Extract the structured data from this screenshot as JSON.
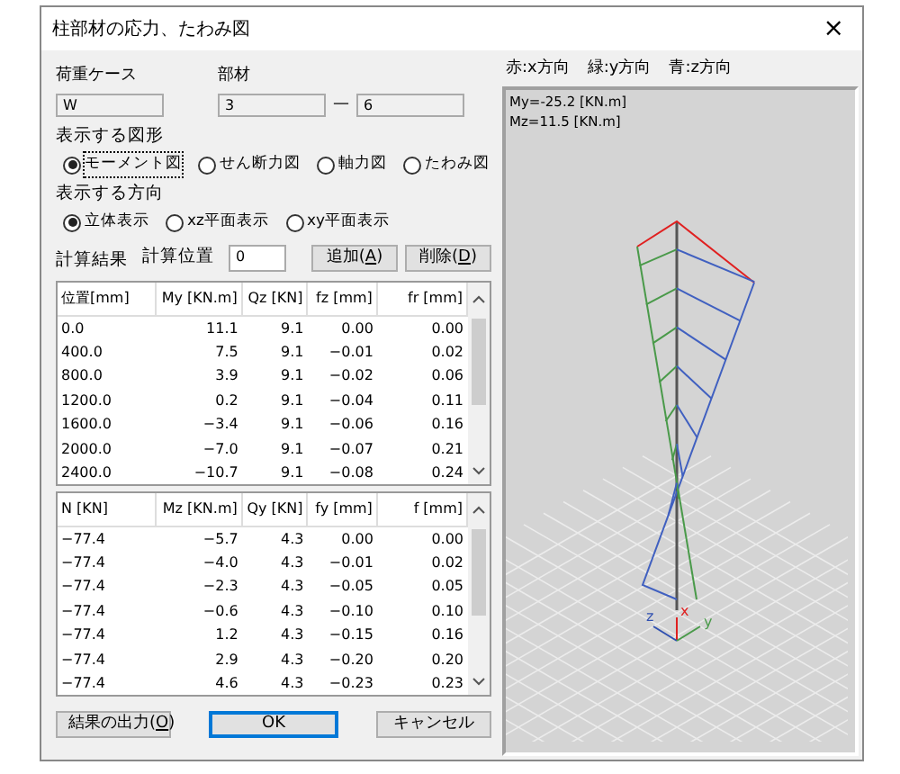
{
  "window": {
    "title": "柱部材の応力、たわみ図",
    "close": "×"
  },
  "load_case": {
    "label": "荷重ケース",
    "value": "W",
    "disabled": true
  },
  "member": {
    "label": "部材",
    "from": "3",
    "separator": "—",
    "to": "6",
    "disabled": true
  },
  "shape": {
    "label": "表示する図形",
    "options": [
      {
        "label": "モーメント図",
        "selected": true
      },
      {
        "label": "せん断力図",
        "selected": false
      },
      {
        "label": "軸力図",
        "selected": false
      },
      {
        "label": "たわみ図",
        "selected": false
      }
    ]
  },
  "direction": {
    "label": "表示する方向",
    "options": [
      {
        "label": "立体表示",
        "selected": true
      },
      {
        "label": "xz平面表示",
        "selected": false
      },
      {
        "label": "xy平面表示",
        "selected": false
      }
    ]
  },
  "results": {
    "label": "計算結果",
    "position_label": "計算位置",
    "position_value": "0",
    "buttons": [
      {
        "label_before": "追加(",
        "access_key": "A",
        "label_after": ")"
      },
      {
        "label_before": "削除(",
        "access_key": "D",
        "label_after": ")"
      }
    ]
  },
  "table_1": {
    "columns": [
      "位置[mm]",
      "My [KN.m]",
      "Qz [KN]",
      "fz [mm]",
      "fr [mm]"
    ],
    "rows": [
      [
        "0.0",
        "11.1",
        "9.1",
        "0.00",
        "0.00"
      ],
      [
        "400.0",
        "7.5",
        "9.1",
        "−0.01",
        "0.02"
      ],
      [
        "800.0",
        "3.9",
        "9.1",
        "−0.02",
        "0.06"
      ],
      [
        "1200.0",
        "0.2",
        "9.1",
        "−0.04",
        "0.11"
      ],
      [
        "1600.0",
        "−3.4",
        "9.1",
        "−0.06",
        "0.16"
      ],
      [
        "2000.0",
        "−7.0",
        "9.1",
        "−0.07",
        "0.21"
      ],
      [
        "2400.0",
        "−10.7",
        "9.1",
        "−0.08",
        "0.24"
      ]
    ]
  },
  "table_2": {
    "columns": [
      "N [KN]",
      "Mz [KN.m]",
      "Qy [KN]",
      "fy [mm]",
      "f [mm]"
    ],
    "rows": [
      [
        "−77.4",
        "−5.7",
        "4.3",
        "0.00",
        "0.00"
      ],
      [
        "−77.4",
        "−4.0",
        "4.3",
        "−0.01",
        "0.02"
      ],
      [
        "−77.4",
        "−2.3",
        "4.3",
        "−0.05",
        "0.05"
      ],
      [
        "−77.4",
        "−0.6",
        "4.3",
        "−0.10",
        "0.10"
      ],
      [
        "−77.4",
        "1.2",
        "4.3",
        "−0.15",
        "0.16"
      ],
      [
        "−77.4",
        "2.9",
        "4.3",
        "−0.20",
        "0.20"
      ],
      [
        "−77.4",
        "4.6",
        "4.3",
        "−0.23",
        "0.23"
      ]
    ]
  },
  "footer": [
    {
      "label_before": "結果の出力(",
      "access_key": "O",
      "label_after": ")",
      "default": false
    },
    {
      "label_before": "OK",
      "default": true
    },
    {
      "label_before": "キャンセル",
      "default": false
    }
  ],
  "legend": [
    "赤:x方向",
    "緑:y方向",
    "青:z方向"
  ],
  "viewport": {
    "readouts": [
      "My=-25.2 [KN.m]",
      "Mz=11.5 [KN.m]"
    ],
    "axes": [
      "z",
      "x",
      "y"
    ]
  }
}
